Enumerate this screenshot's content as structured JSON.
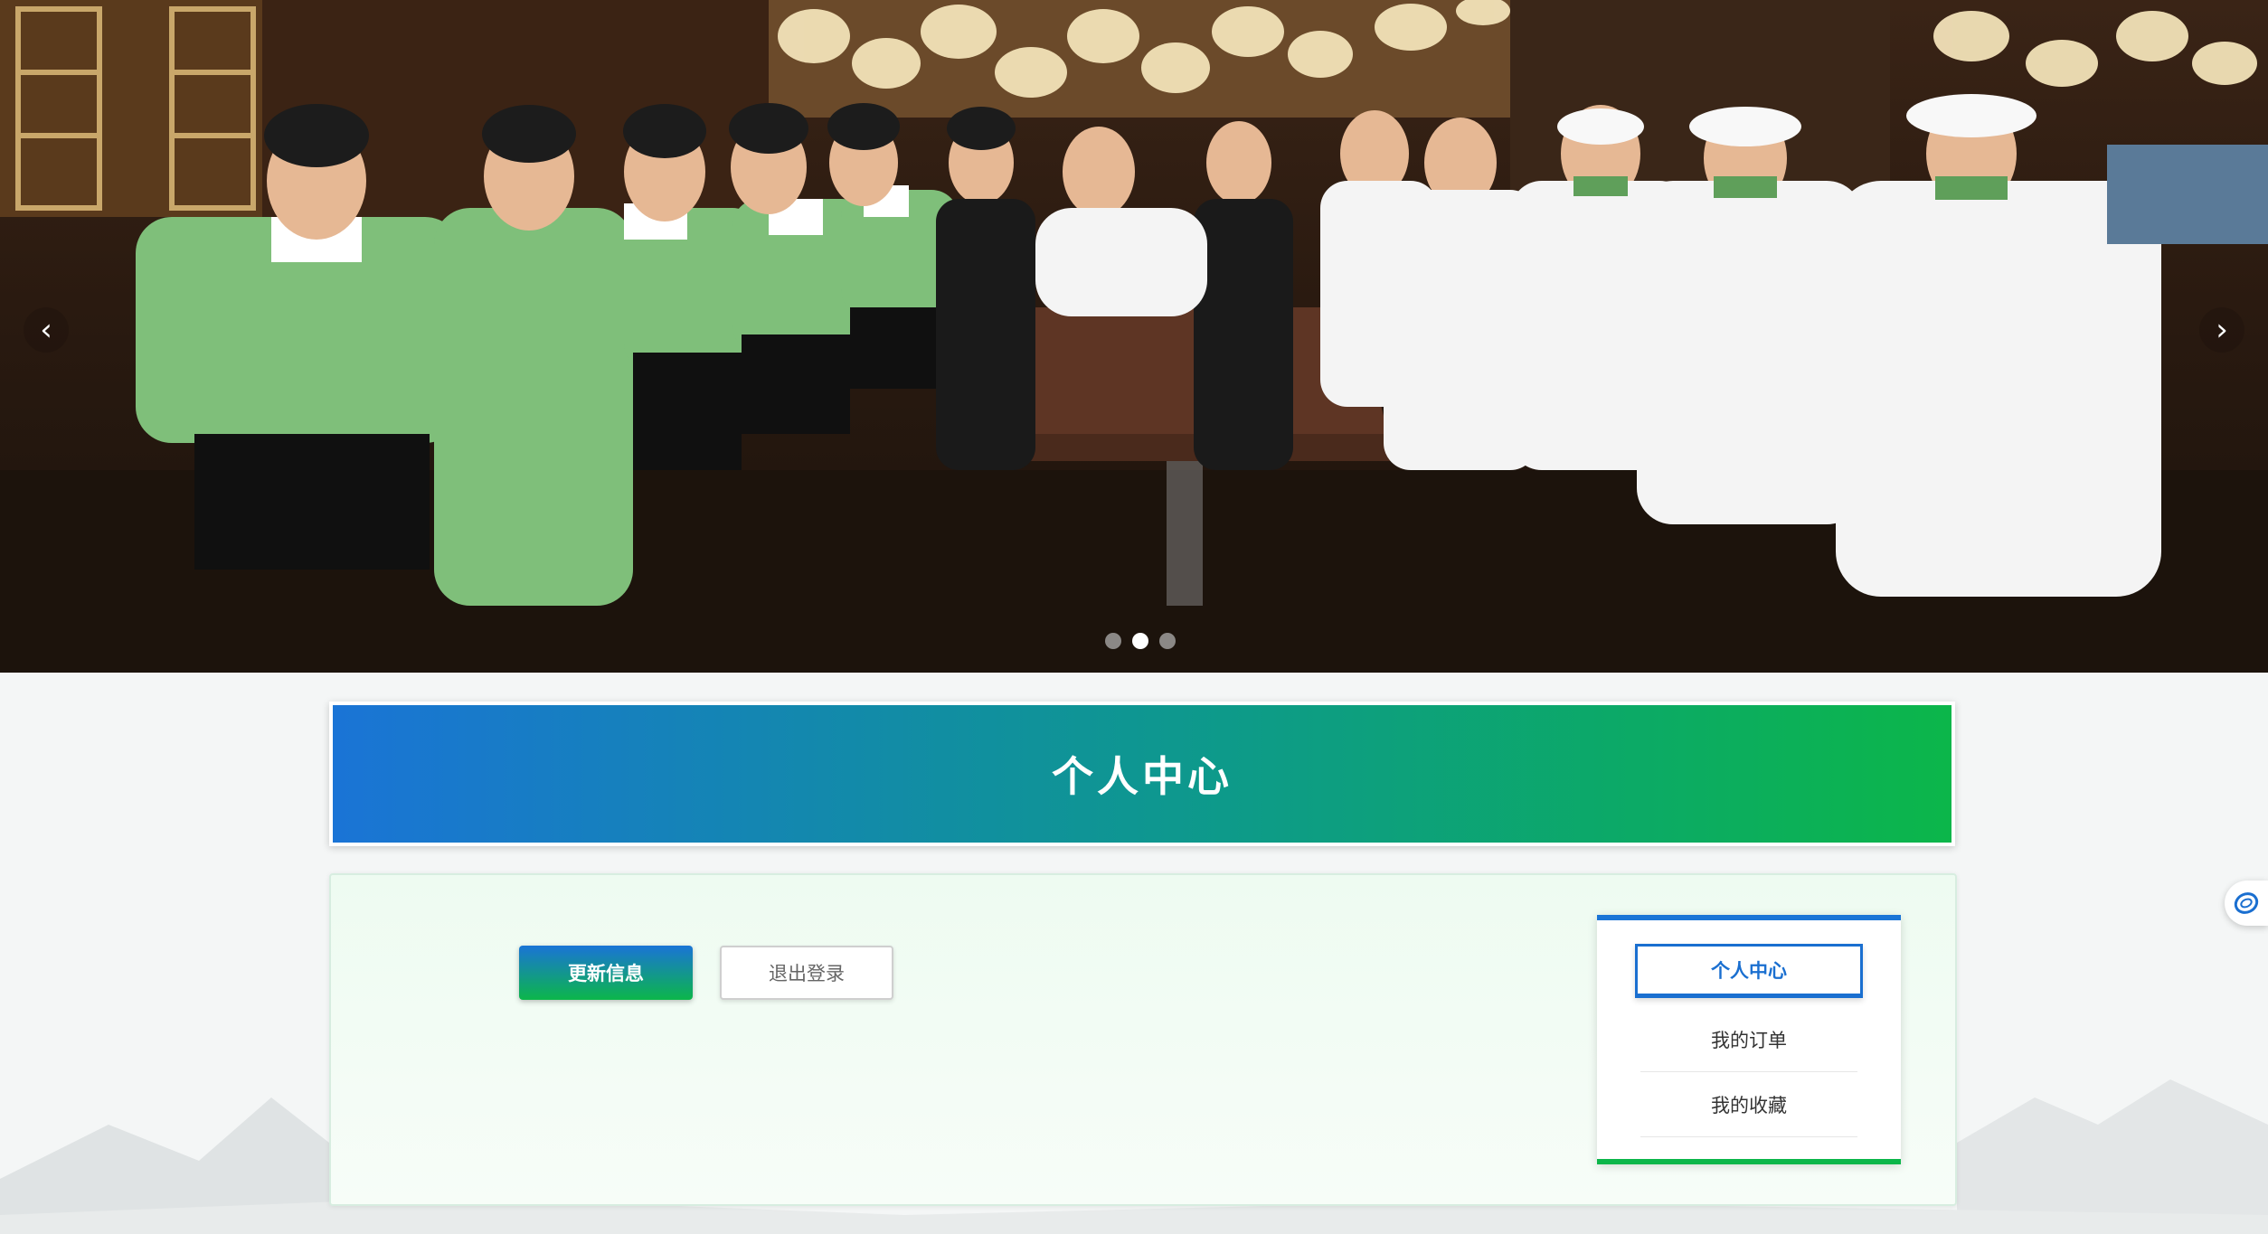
{
  "hero": {
    "prev_arrow": "‹",
    "next_arrow": "›",
    "slides": [
      {
        "state": "inactive"
      },
      {
        "state": "active"
      },
      {
        "state": "inactive"
      }
    ],
    "active_slide": 2
  },
  "header": {
    "title": "个人中心"
  },
  "actions": {
    "update_label": "更新信息",
    "logout_label": "退出登录"
  },
  "side_menu": {
    "items": [
      {
        "label": "个人中心",
        "active": true
      },
      {
        "label": "我的订单",
        "active": false
      },
      {
        "label": "我的收藏",
        "active": false
      }
    ]
  },
  "colors": {
    "brand_blue": "#1a74d6",
    "brand_green": "#0cb64a"
  },
  "icons": {
    "float_widget": "chat-bubble-icon"
  }
}
